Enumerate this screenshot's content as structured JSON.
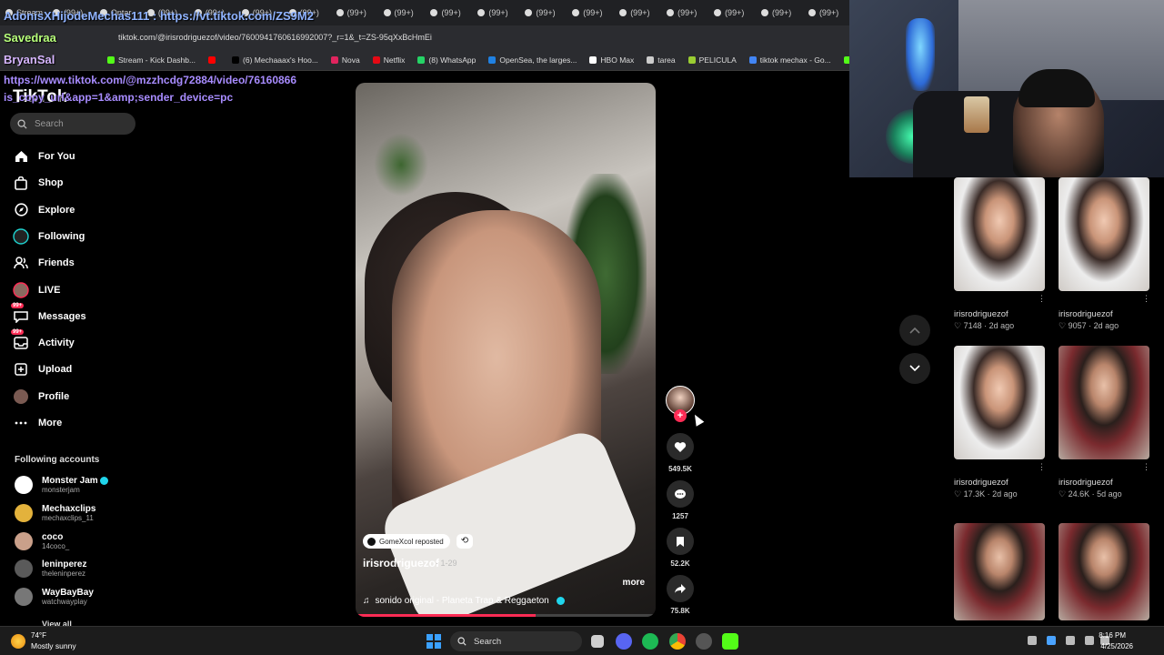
{
  "browser": {
    "tabs": [
      "Stream",
      "(99+)",
      "Ontar",
      "(99+)",
      "(99+)",
      "(99+)",
      "(99+)",
      "(99+)",
      "(99+)",
      "(99+)",
      "(99+)",
      "(99+)",
      "(99+)",
      "(99+)",
      "(99+)",
      "(99+)",
      "(99+)",
      "(99+)"
    ],
    "url": "tiktok.com/@irisrodriguezof/video/7600941760616992007?_r=1&_t=ZS-95qXxBcHmEi",
    "bookmarks": [
      {
        "label": "Stream - Kick Dashb...",
        "color": "#53fc18"
      },
      {
        "label": "",
        "color": "#ff0000"
      },
      {
        "label": "(6) Mechaaax's Hoo...",
        "color": "#000000"
      },
      {
        "label": "Nova",
        "color": "#e0245e"
      },
      {
        "label": "Netflix",
        "color": "#e50914"
      },
      {
        "label": "(8) WhatsApp",
        "color": "#25d366"
      },
      {
        "label": "OpenSea, the larges...",
        "color": "#2081e2"
      },
      {
        "label": "HBO Max",
        "color": "#ffffff"
      },
      {
        "label": "tarea",
        "color": "#cccccc"
      },
      {
        "label": "PELICULA",
        "color": "#9acd32"
      },
      {
        "label": "tiktok mechax - Go...",
        "color": "#4285f4"
      },
      {
        "label": "Turn You",
        "color": "#53fc18"
      }
    ]
  },
  "chat_overlay": {
    "line1": "AdonisXHijodeMechas111 : https://vt.tiktok.com/ZS9M2",
    "line2": "Savedraa",
    "line3": "BryanSal",
    "line4a": "https://www.tiktok.com/@mzzhcdg72884/video/76160866",
    "line4b": "is_copy_url&app=1&amp;sender_device=pc"
  },
  "sidebar": {
    "logo": "TikTok",
    "search_placeholder": "Search",
    "nav": [
      {
        "label": "For You",
        "icon": "home-icon",
        "badge": ""
      },
      {
        "label": "Shop",
        "icon": "shopping-bag-icon",
        "badge": ""
      },
      {
        "label": "Explore",
        "icon": "compass-icon",
        "badge": ""
      },
      {
        "label": "Following",
        "icon": "following-avatar-icon",
        "badge": ""
      },
      {
        "label": "Friends",
        "icon": "friends-icon",
        "badge": ""
      },
      {
        "label": "LIVE",
        "icon": "live-avatar-icon",
        "badge": ""
      },
      {
        "label": "Messages",
        "icon": "message-icon",
        "badge": "99+"
      },
      {
        "label": "Activity",
        "icon": "inbox-icon",
        "badge": "99+"
      },
      {
        "label": "Upload",
        "icon": "upload-icon",
        "badge": ""
      },
      {
        "label": "Profile",
        "icon": "profile-avatar-icon",
        "badge": ""
      },
      {
        "label": "More",
        "icon": "more-icon",
        "badge": ""
      }
    ],
    "following_title": "Following accounts",
    "accounts": [
      {
        "name": "Monster Jam",
        "handle": "monsterjam",
        "verified": true,
        "color": "#ffffff"
      },
      {
        "name": "Mechaxclips",
        "handle": "mechaxclips_11",
        "verified": false,
        "color": "#e3b23c"
      },
      {
        "name": "coco",
        "handle": "14coco_",
        "verified": false,
        "color": "#caa08a"
      },
      {
        "name": "leninperez",
        "handle": "theleninperez",
        "verified": false,
        "color": "#5a5a5a"
      },
      {
        "name": "WayBayBay",
        "handle": "watchwayplay",
        "verified": false,
        "color": "#777777"
      }
    ],
    "view_all": "View all"
  },
  "video": {
    "repost_label": "GomeXcol reposted",
    "author": "irisrodriguezof",
    "duration": "· 1-29",
    "more": "more",
    "music": "sonido original - Planeta Trap & Reggaeton",
    "progress": 0.6
  },
  "actions": {
    "likes": "549.5K",
    "comments": "1257",
    "saves": "52.2K",
    "shares": "75.8K"
  },
  "grid": [
    {
      "author": "irisrodriguezof",
      "likes": "7148",
      "age": "2d ago",
      "style": "a"
    },
    {
      "author": "irisrodriguezof",
      "likes": "9057",
      "age": "2d ago",
      "style": "a"
    },
    {
      "author": "irisrodriguezof",
      "likes": "17.3K",
      "age": "2d ago",
      "style": "a"
    },
    {
      "author": "irisrodriguezof",
      "likes": "24.6K",
      "age": "5d ago",
      "style": "b"
    },
    {
      "author": "",
      "likes": "",
      "age": "",
      "style": "b"
    },
    {
      "author": "",
      "likes": "",
      "age": "",
      "style": "b"
    }
  ],
  "taskbar": {
    "temp": "74°F",
    "weather": "Mostly sunny",
    "search": "Search",
    "time": "8:16 PM",
    "date": "4/25/2026"
  }
}
